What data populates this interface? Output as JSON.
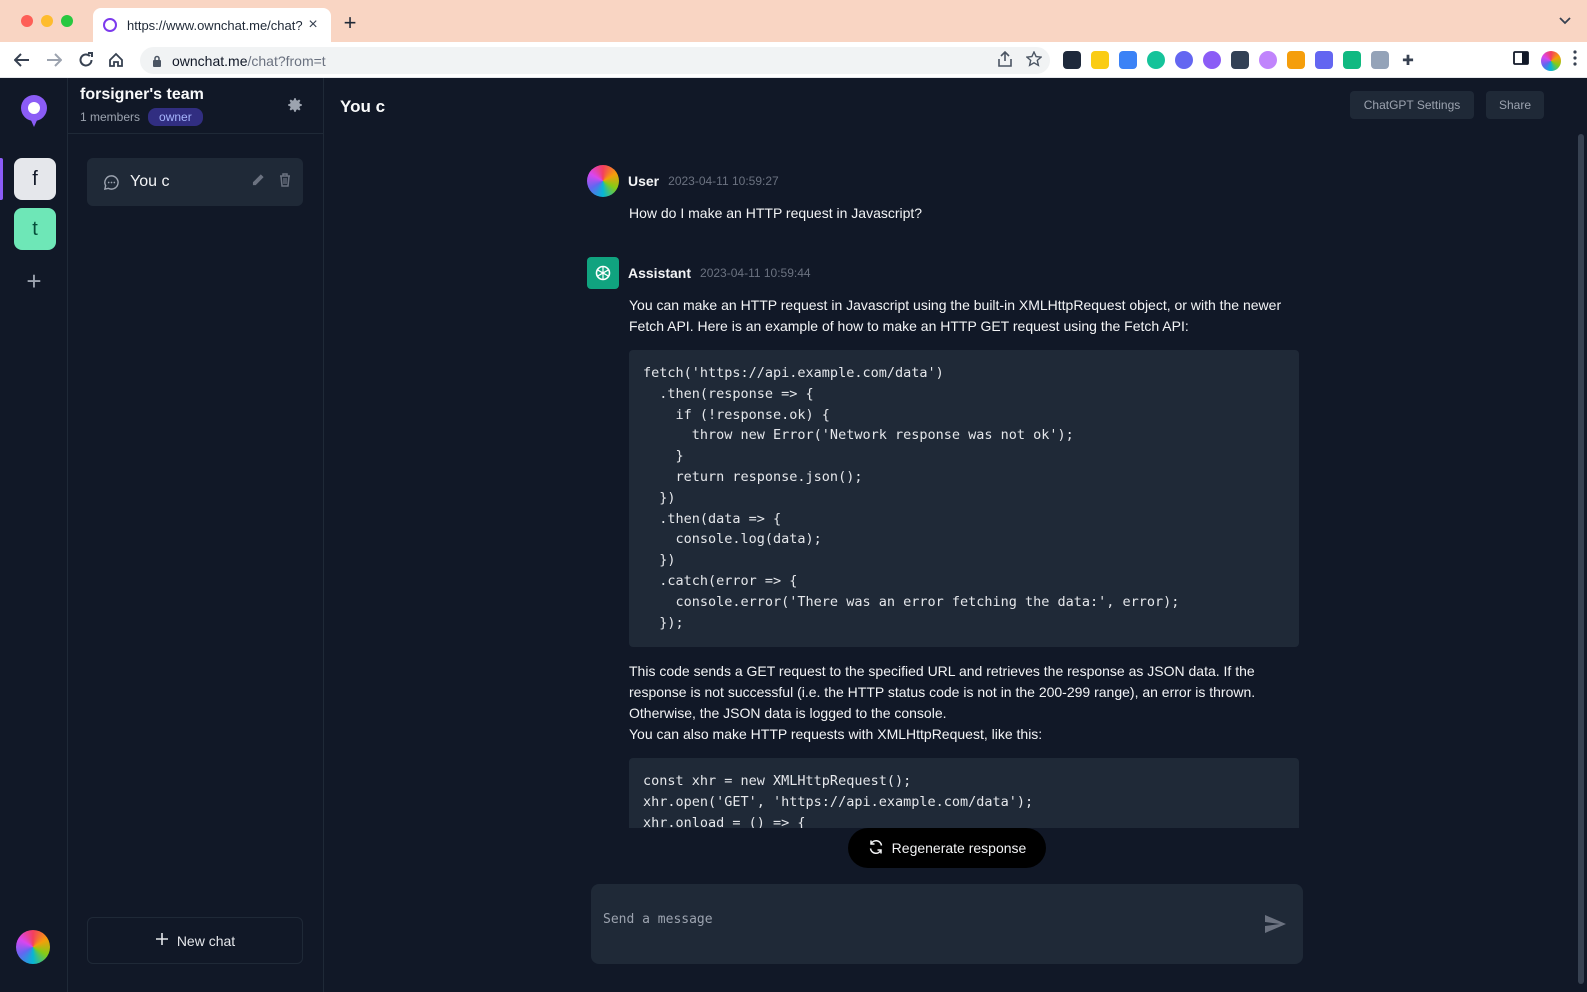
{
  "browser": {
    "tab_title": "https://www.ownchat.me/chat?",
    "url_host": "ownchat.me",
    "url_path": "/chat?from=t"
  },
  "workspaces": [
    {
      "letter": "f"
    },
    {
      "letter": "t"
    }
  ],
  "sidebar": {
    "team_name": "forsigner's team",
    "members": "1 members",
    "role_badge": "owner",
    "chats": [
      {
        "label": "You c"
      }
    ],
    "new_chat_label": "New chat"
  },
  "header": {
    "title": "You c",
    "settings_label": "ChatGPT Settings",
    "share_label": "Share"
  },
  "messages": [
    {
      "author": "User",
      "time": "2023-04-11 10:59:27",
      "text": "How do I make an HTTP request in Javascript?"
    },
    {
      "author": "Assistant",
      "time": "2023-04-11 10:59:44",
      "intro": "You can make an HTTP request in Javascript using the built-in XMLHttpRequest object, or with the newer Fetch API. Here is an example of how to make an HTTP GET request using the Fetch API:",
      "code1": "fetch('https://api.example.com/data')\n  .then(response => {\n    if (!response.ok) {\n      throw new Error('Network response was not ok');\n    }\n    return response.json();\n  })\n  .then(data => {\n    console.log(data);\n  })\n  .catch(error => {\n    console.error('There was an error fetching the data:', error);\n  });",
      "explanation": "This code sends a GET request to the specified URL and retrieves the response as JSON data. If the response is not successful (i.e. the HTTP status code is not in the 200-299 range), an error is thrown. Otherwise, the JSON data is logged to the console.",
      "followup": "You can also make HTTP requests with XMLHttpRequest, like this:",
      "code2": "const xhr = new XMLHttpRequest();\nxhr.open('GET', 'https://api.example.com/data');\nxhr.onload = () => {"
    }
  ],
  "regenerate_label": "Regenerate response",
  "composer": {
    "placeholder": "Send a message"
  },
  "colors": {
    "background": "#111827",
    "panel": "#1f2937",
    "accent": "#8b5cf6",
    "assistant": "#10a37f"
  }
}
